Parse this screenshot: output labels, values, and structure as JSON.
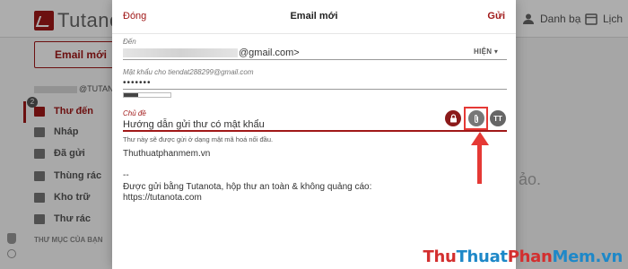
{
  "background": {
    "logo_text": "Tutanota",
    "header_contacts": "Danh bạ",
    "header_calendar": "Lịch",
    "new_mail_button": "Email mới",
    "account_suffix": "@TUTANOT",
    "badge_count": "2",
    "folders": [
      {
        "label": "Thư đến"
      },
      {
        "label": "Nháp"
      },
      {
        "label": "Đã gửi"
      },
      {
        "label": "Thùng rác"
      },
      {
        "label": "Kho trữ"
      },
      {
        "label": "Thư rác"
      }
    ],
    "folder_section": "THƯ MỤC CỦA BẠN",
    "right_hint": "ảo."
  },
  "dialog": {
    "close_label": "Đóng",
    "title": "Email mới",
    "send_label": "Gửi",
    "to_label": "Đến",
    "to_value_suffix": "@gmail.com>",
    "show_label": "HIỆN ▾",
    "password_label": "Mật khẩu cho tiendat288299@gmail.com",
    "password_value": "•••••••",
    "password_strength": 0.3,
    "subject_label": "Chủ đề",
    "subject_value": "Hướng dẫn gửi thư có mật khẩu",
    "subject_hint": "Thư này sẽ được gửi ở dạng mật mã hoá nối đầu.",
    "tt_label": "TT",
    "body_lines": [
      "Thuthuatphanmem.vn",
      "--",
      "Được gửi bằng Tutanota, hộp thư an toàn & không quảng cáo:",
      "https://tutanota.com"
    ]
  },
  "watermark": {
    "part1": "Thu",
    "part2": "Thuat",
    "part3": "Phan",
    "part4": "Mem",
    "suffix": ".vn"
  },
  "colors": {
    "accent": "#a01818",
    "annotation": "#e53935"
  }
}
